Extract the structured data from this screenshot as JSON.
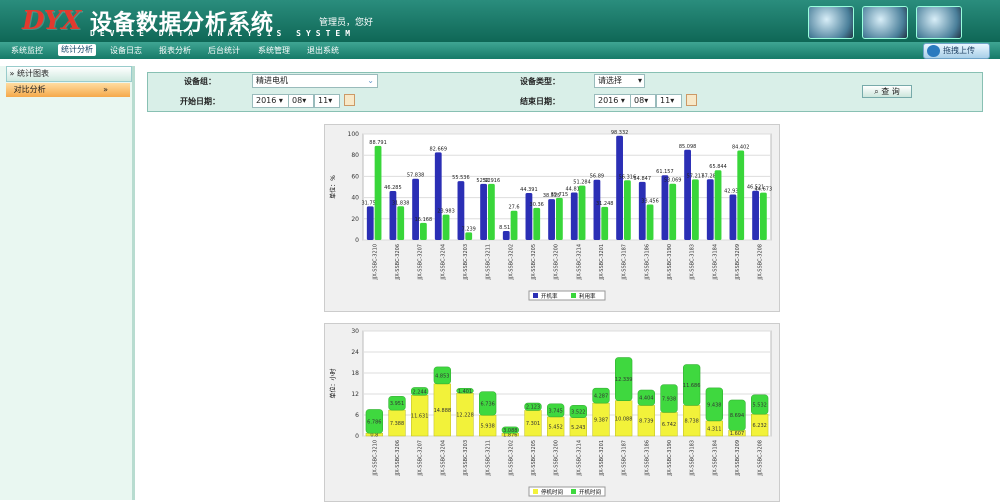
{
  "header": {
    "logo": "DYX",
    "title_cn": "设备数据分析系统",
    "title_en": "DEVICE DATA ANALYSIS SYSTEM",
    "user": "管理员，您好"
  },
  "nav": {
    "items": [
      "系统监控",
      "统计分析",
      "设备日志",
      "报表分析",
      "后台统计",
      "系统管理",
      "退出系统"
    ],
    "active": 1,
    "upload_label": "拖拽上传"
  },
  "sidebar": {
    "heading": "统计图表",
    "item": "对比分析"
  },
  "filter": {
    "group_label": "设备组：",
    "group_value": "精进电机",
    "type_label": "设备类型：",
    "type_value": "请选择",
    "start_label": "开始日期：",
    "start_year": "2016",
    "start_month": "08",
    "start_day": "11",
    "end_label": "结束日期：",
    "end_year": "2016",
    "end_month": "08",
    "end_day": "11",
    "query_label": "查 询"
  },
  "chart_data": [
    {
      "type": "bar",
      "ylabel": "单位：%",
      "ylim": [
        0,
        100
      ],
      "yticks": [
        0,
        20,
        40,
        60,
        80,
        100
      ],
      "categories": [
        "JJX-SSBC-3210",
        "JJX-SSBC-3206",
        "JJX-SSBC-3207",
        "JJX-SSBC-3204",
        "JJX-SSBC-3203",
        "JJX-SSBC-3211",
        "JJX-SSBC-3202",
        "JJX-SSBC-3205",
        "JJX-SSBC-3200",
        "JJX-SSBC-3214",
        "JJX-SSBC-3201",
        "JJX-SSBC-3187",
        "JJX-SSBC-3186",
        "JJX-SSBC-3190",
        "JJX-SSBC-3183",
        "JJX-SSBC-3184",
        "JJX-SSBC-3209",
        "JJX-SSBC-3208"
      ],
      "series": [
        {
          "name": "开机率",
          "color": "#2b2fb5",
          "values": [
            31.752,
            46.285,
            57.838,
            82.669,
            55.536,
            52.916,
            8.511,
            44.391,
            38.525,
            44.815,
            56.89,
            98.332,
            54.847,
            61.137,
            85.098,
            57.283,
            42.938,
            46.521
          ],
          "labels": [
            "31.752",
            "46.285",
            "57.838",
            "82.669",
            "55.536",
            "52.92",
            "8.511",
            "44.391",
            "38.525",
            "44.815",
            "56.89",
            "98.332",
            "54.847",
            "61.157",
            "85.098",
            "57.283",
            "42.938",
            "46.521"
          ]
        },
        {
          "name": "利用率",
          "color": "#39d63a",
          "values": [
            88.791,
            31.838,
            16.168,
            23.983,
            7.239,
            52.916,
            27.6,
            30.36,
            39.715,
            51.284,
            31.248,
            56.316,
            33.456,
            53.069,
            57.217,
            65.844,
            84.402,
            44.673
          ],
          "labels": [
            "88.791",
            "31.838",
            "16.168",
            "23.983",
            "7.239",
            "52.916",
            "27.6",
            "30.36",
            "39.715",
            "51.284",
            "31.248",
            "56.316",
            "33.456",
            "53.069",
            "57.217",
            "65.844",
            "84.402",
            "44.673"
          ]
        }
      ],
      "legend_position": "bottom"
    },
    {
      "type": "bar",
      "stacked": true,
      "ylabel": "单位：小时",
      "ylim": [
        0,
        30
      ],
      "yticks": [
        0,
        6,
        12,
        18,
        24,
        30
      ],
      "categories": [
        "JJX-SSBC-3210",
        "JJX-SSBC-3206",
        "JJX-SSBC-3207",
        "JJX-SSBC-3204",
        "JJX-SSBC-3203",
        "JJX-SSBC-3211",
        "JJX-SSBC-3202",
        "JJX-SSBC-3205",
        "JJX-SSBC-3200",
        "JJX-SSBC-3214",
        "JJX-SSBC-3201",
        "JJX-SSBC-3187",
        "JJX-SSBC-3186",
        "JJX-SSBC-3190",
        "JJX-SSBC-3183",
        "JJX-SSBC-3184",
        "JJX-SSBC-3209",
        "JJX-SSBC-3208"
      ],
      "series": [
        {
          "name": "停机时间",
          "color": "#f2f23a",
          "values": [
            0.8,
            7.388,
            11.631,
            14.888,
            12.228,
            5.938,
            0.8,
            7.301,
            5.452,
            5.243,
            9.387,
            10.088,
            8.739,
            6.742,
            8.738,
            4.311,
            1.607,
            6.232
          ]
        },
        {
          "name": "开机时间",
          "color": "#3fd83f",
          "values": [
            6.786,
            3.951,
            2.244,
            4.853,
            1.401,
            6.736,
            1.8,
            2.123,
            3.745,
            3.522,
            4.287,
            12.339,
            4.404,
            7.938,
            11.686,
            9.438,
            8.694,
            5.532
          ]
        }
      ],
      "labels_bottom": [
        "0.8",
        "7.388",
        "11.631",
        "14.888",
        "12.228",
        "5.938",
        "1.876",
        "7.301",
        "5.452",
        "5.243",
        "9.387",
        "10.088",
        "8.739",
        "6.742",
        "8.738",
        "4.311",
        "1.607",
        "6.232"
      ],
      "labels_top": [
        "6.786",
        "3.951",
        "2.244",
        "4.853",
        "1.401",
        "6.736",
        "3.088",
        "2.123",
        "3.745",
        "3.522",
        "4.287",
        "12.339",
        "4.404",
        "7.938",
        "11.686",
        "9.438",
        "8.694",
        "5.532"
      ],
      "legend_position": "bottom"
    }
  ]
}
